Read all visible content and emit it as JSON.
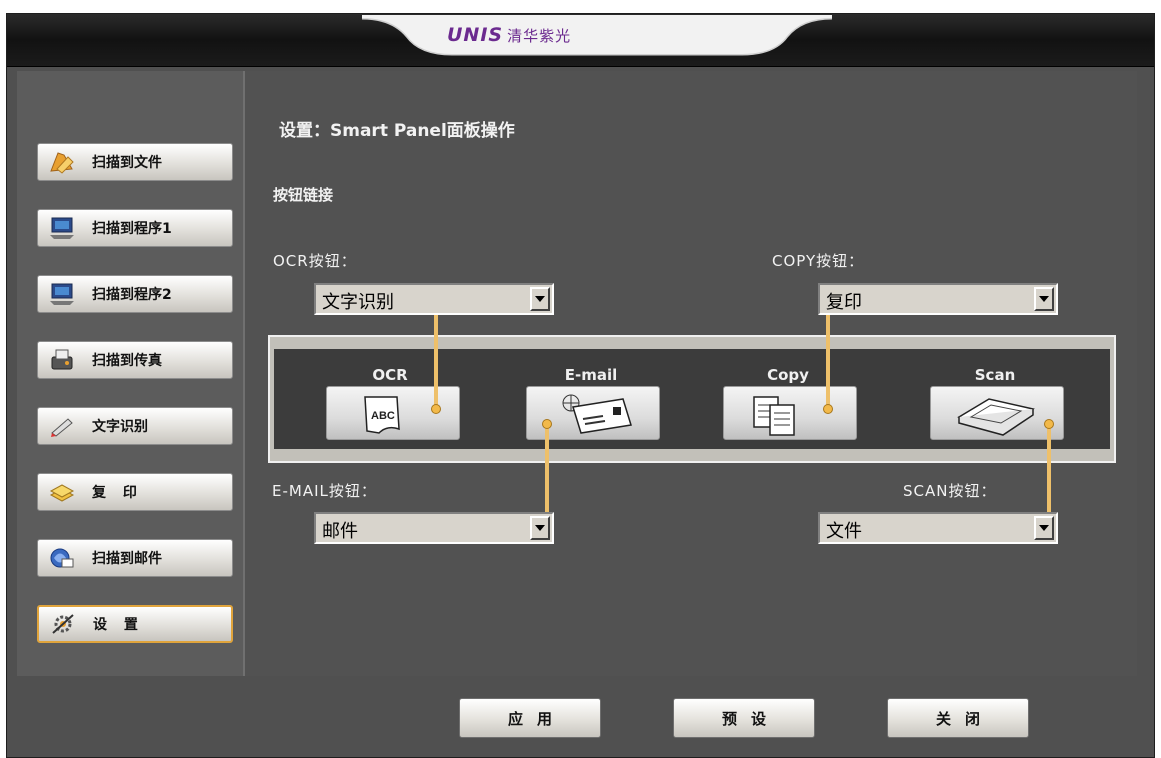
{
  "brand": {
    "logo": "UNIS",
    "name": "清华紫光"
  },
  "sidebar": {
    "items": [
      {
        "label": "扫描到文件",
        "icon": "folder-icon"
      },
      {
        "label": "扫描到程序1",
        "icon": "app1-icon"
      },
      {
        "label": "扫描到程序2",
        "icon": "app2-icon"
      },
      {
        "label": "扫描到传真",
        "icon": "fax-icon"
      },
      {
        "label": "文字识别",
        "icon": "ocr-pen-icon"
      },
      {
        "label": "复 印",
        "icon": "copy-stack-icon"
      },
      {
        "label": "扫描到邮件",
        "icon": "mail-icon"
      },
      {
        "label": "设 置",
        "icon": "settings-icon",
        "active": true
      }
    ]
  },
  "main": {
    "title": "设置：Smart Panel面板操作",
    "section": "按钮链接",
    "ocr": {
      "label": "OCR按钮：",
      "value": "文字识别"
    },
    "copy": {
      "label": "COPY按钮：",
      "value": "复印"
    },
    "email": {
      "label": "E-MAIL按钮：",
      "value": "邮件"
    },
    "scan": {
      "label": "SCAN按钮：",
      "value": "文件"
    },
    "panel_buttons": [
      {
        "label": "OCR",
        "icon": "abc-document-icon"
      },
      {
        "label": "E-mail",
        "icon": "envelope-globe-icon"
      },
      {
        "label": "Copy",
        "icon": "copy-documents-icon"
      },
      {
        "label": "Scan",
        "icon": "scanner-icon"
      }
    ]
  },
  "footer": {
    "apply": "应用",
    "preset": "预设",
    "close": "关闭"
  },
  "colors": {
    "accent": "#e0a43c",
    "connector": "#eec06a",
    "brand": "#6b2a8f"
  }
}
